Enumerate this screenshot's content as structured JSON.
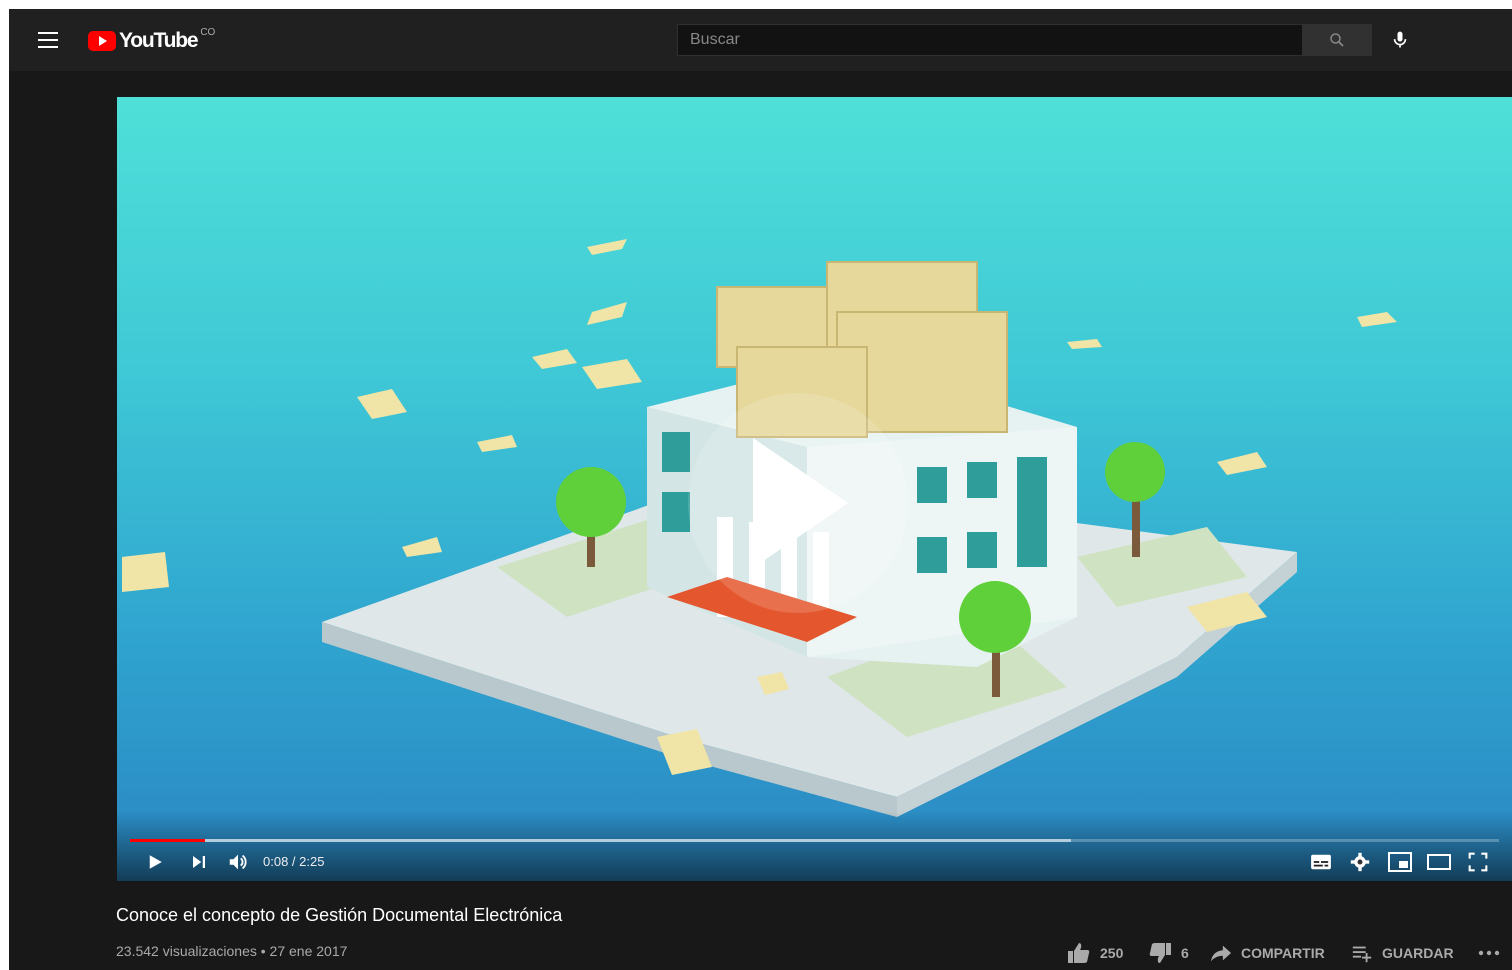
{
  "header": {
    "brand": "YouTube",
    "country_code": "CO",
    "search_placeholder": "Buscar"
  },
  "player": {
    "current_time": "0:08",
    "duration": "2:25",
    "time_display": "0:08 / 2:25",
    "played_fraction": 0.055,
    "buffered_fraction": 0.687
  },
  "video": {
    "title": "Conoce el concepto de Gestión Documental Electrónica",
    "views": "23.542 visualizaciones",
    "date": "27 ene 2017",
    "meta_line": "23.542 visualizaciones • 27 ene 2017"
  },
  "actions": {
    "likes": "250",
    "dislikes": "6",
    "share_label": "COMPARTIR",
    "save_label": "GUARDAR"
  },
  "colors": {
    "accent": "#ff0000",
    "background": "#181818",
    "topbar": "#202020"
  },
  "icons": [
    "menu-icon",
    "youtube-logo-icon",
    "search-icon",
    "microphone-icon",
    "play-icon",
    "next-icon",
    "volume-icon",
    "subtitles-icon",
    "settings-icon",
    "miniplayer-icon",
    "theater-icon",
    "fullscreen-icon",
    "thumbs-up-icon",
    "thumbs-down-icon",
    "share-icon",
    "playlist-add-icon",
    "more-icon"
  ]
}
